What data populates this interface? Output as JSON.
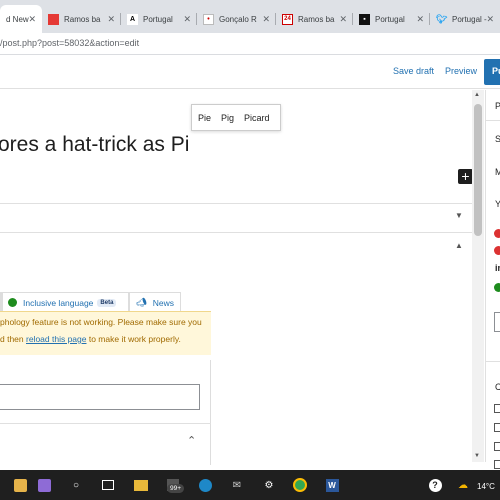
{
  "browser": {
    "tabs": [
      {
        "label": "d New",
        "favicon": "wordpress-icon",
        "active": true
      },
      {
        "label": "Ramos ba",
        "favicon": "red-square-icon"
      },
      {
        "label": "Portugal",
        "favicon": "a-logo-icon"
      },
      {
        "label": "Gonçalo R",
        "favicon": "page-icon"
      },
      {
        "label": "Ramos ba",
        "favicon": "calendar-24-icon"
      },
      {
        "label": "Portugal",
        "favicon": "black-square-icon"
      },
      {
        "label": "Portugal -",
        "favicon": "twitter-icon"
      }
    ],
    "url": "/post.php?post=58032&action=edit"
  },
  "wp_header": {
    "save_draft": "Save draft",
    "preview": "Preview",
    "publish": "Pu"
  },
  "editor": {
    "popover_items": [
      "Pie",
      "Pig",
      "Picard"
    ],
    "title": "ores a hat-trick as Pi",
    "add_block": "+"
  },
  "yoast": {
    "tabs": [
      {
        "label": "Inclusive language",
        "badge": "Beta"
      },
      {
        "label": "News"
      }
    ],
    "notice_line1": "phology feature is not working. Please make sure you",
    "notice_line2_pre": "d then ",
    "notice_link": "reload this page",
    "notice_line2_post": " to make it work properly."
  },
  "sidebar": {
    "items": [
      "P",
      "S",
      "M",
      "Y",
      "in",
      "C"
    ]
  },
  "taskbar": {
    "badge": "99+",
    "temperature": "14°C"
  },
  "colors": {
    "wp_blue": "#2271b1",
    "notice_bg": "#fff7da",
    "taskbar": "#1f1f1f"
  }
}
